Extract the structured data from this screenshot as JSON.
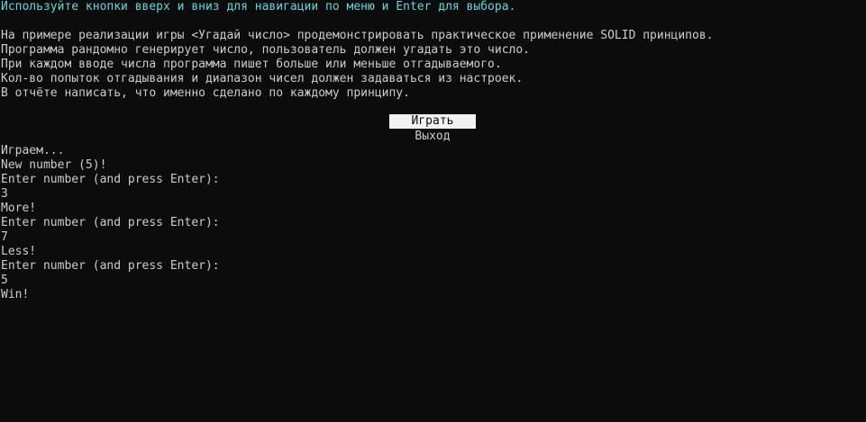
{
  "console": {
    "hint": "Используйте кнопки вверх и вниз для навигации по меню и Enter для выбора.",
    "description": [
      "На примере реализации игры <Угадай число> продемонстрировать практическое применение SOLID принципов.",
      "Программа рандомно генерирует число, пользователь должен угадать это число.",
      "При каждом вводе числа программа пишет больше или меньше отгадываемого.",
      "Кол-во попыток отгадывания и диапазон чисел должен задаваться из настроек.",
      "В отчёте написать, что именно сделано по каждому принципу."
    ],
    "menu": {
      "items": [
        {
          "label": "Играть",
          "selected": true
        },
        {
          "label": "Выход",
          "selected": false
        }
      ]
    },
    "output": [
      "Играем...",
      "New number (5)!",
      "Enter number (and press Enter):",
      "3",
      "More!",
      "Enter number (and press Enter):",
      "7",
      "Less!",
      "Enter number (and press Enter):",
      "5",
      "Win!"
    ]
  },
  "colors": {
    "background": "#0c0c0c",
    "text": "#cccccc",
    "hint": "#61d6d6",
    "selected_bg": "#f2f2f2",
    "selected_text": "#0c0c0c"
  }
}
